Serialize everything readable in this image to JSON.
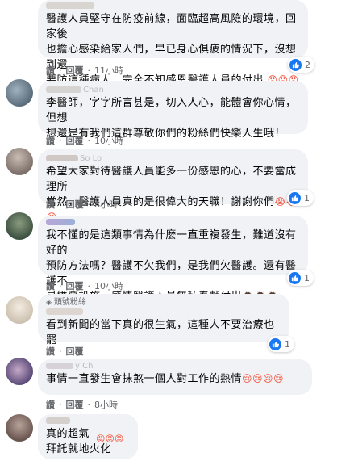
{
  "actions": {
    "like": "讚",
    "reply": "回覆"
  },
  "comments": [
    {
      "text": "醫護人員堅守在防疫前線，面臨超高風險的環境，回家後\n也擔心感染給家人們，早已身心俱疲的情況下，沒想到還\n要防這種病人，完全不知感恩醫護人員的付出",
      "emojis": "😡😡😡",
      "time": "11小時",
      "reactions": "2",
      "avatar_color": "#c7b9a6"
    },
    {
      "author_fragment": "Chan",
      "text": "李醫師，字字所言甚是，切入人心，能體會你心情，但想\n想還是有我們這群尊敬你們的粉絲們快樂人生哦！",
      "time": "10小時",
      "avatar_color": "#6b7f8e"
    },
    {
      "author_fragment": "So Lo",
      "text": "希望大家對待醫護人員能多一份感恩的心，不要當成理所\n當然，醫護人員真的是很偉大的天職！謝謝你們",
      "emojis": "😭😭😭",
      "time": "8小時",
      "reactions": "1",
      "avatar_color": "#9a8f88"
    },
    {
      "text": "我不懂的是這類事情為什麼一直重複發生，難道沒有好的\n預防方法嗎？醫護不欠我們，是我們欠醫護。還有醫護不\n是嫌惡設施～感情醫護人員無私奉獻付出",
      "emojis": "🙇🙇🙇",
      "time": "10小時",
      "reactions": "1",
      "avatar_color": "#506a55"
    },
    {
      "badge": "頭號粉絲",
      "text": "看到新聞的當下真的很生氣，這種人不要治療也罷",
      "reactions": "1",
      "avatar_color": "#e3d9c6"
    },
    {
      "author_fragment": "y Ch",
      "text": "事情一直發生會抹煞一個人對工作的熱情",
      "emojis": "😢😢😢😢",
      "time": "8小時",
      "avatar_color": "#7b6a8d"
    },
    {
      "text": "真的超氣\n拜託就地火化",
      "emojis": "😡😡😡",
      "time": "9小時",
      "avatar_color": "#8f7b72"
    }
  ],
  "colors": {
    "bubble": "#f0f2f5",
    "like_blue": "#1877f2",
    "meta": "#65676b"
  }
}
